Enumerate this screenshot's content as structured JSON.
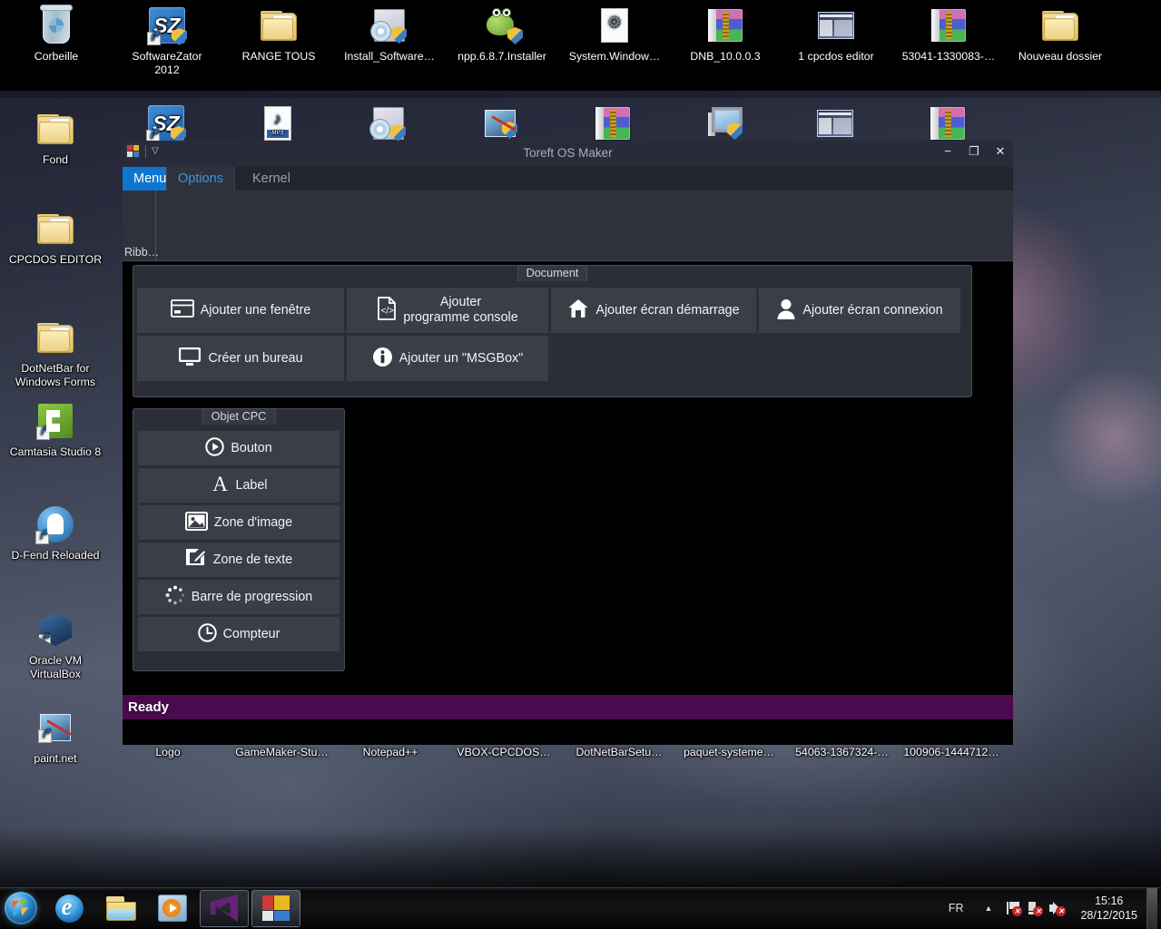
{
  "desktop": {
    "icons_row1": [
      {
        "label": "Corbeille",
        "icon": "recycle-bin-icon"
      },
      {
        "label": "SoftwareZator 2012",
        "icon": "softwarezator-icon"
      },
      {
        "label": "RANGE TOUS",
        "icon": "folder-icon"
      },
      {
        "label": "Install_Software…",
        "icon": "installer-icon"
      },
      {
        "label": "npp.6.8.7.Installer",
        "icon": "notepadpp-installer-icon"
      },
      {
        "label": "System.Window…",
        "icon": "system-file-icon"
      },
      {
        "label": "DNB_10.0.0.3",
        "icon": "winrar-archive-icon"
      },
      {
        "label": "1 cpcdos editor",
        "icon": "screenshot-icon"
      },
      {
        "label": "53041-1330083-…",
        "icon": "winrar-archive-icon"
      },
      {
        "label": "Nouveau dossier",
        "icon": "folder-icon"
      }
    ],
    "icons_row2": [
      {
        "icon": "softwarezator-icon"
      },
      {
        "icon": "mp3-file-icon"
      },
      {
        "icon": "installer-icon"
      },
      {
        "icon": "paintnet-installer-icon"
      },
      {
        "icon": "winrar-archive-icon"
      },
      {
        "icon": "system-config-icon"
      },
      {
        "icon": "screenshot-icon"
      },
      {
        "icon": "winrar-archive-icon"
      }
    ],
    "icons_left": [
      {
        "label": "Fond",
        "icon": "folder-icon"
      },
      {
        "label": "CPCDOS EDITOR",
        "icon": "folder-icon"
      },
      {
        "label": "DotNetBar for Windows Forms",
        "icon": "folder-icon"
      },
      {
        "label": "Camtasia Studio 8",
        "icon": "camtasia-icon"
      },
      {
        "label": "D-Fend Reloaded",
        "icon": "dfend-icon"
      },
      {
        "label": "Oracle VM VirtualBox",
        "icon": "virtualbox-icon"
      },
      {
        "label": "paint.net",
        "icon": "paintnet-icon"
      }
    ]
  },
  "window": {
    "title": "Toreft OS Maker",
    "quick_access": {
      "logo": "app-logo-icon",
      "dropdown": "chevron-down-icon"
    },
    "controls": {
      "minimize": "−",
      "maximize": "❐",
      "close": "✕"
    },
    "tabs": [
      {
        "label": "Menu",
        "state": "application"
      },
      {
        "label": "Options",
        "state": "selected"
      },
      {
        "label": "Kernel",
        "state": "normal"
      }
    ],
    "ribbon_group_label": "Ribb…",
    "panels": {
      "document": {
        "caption": "Document",
        "buttons": [
          {
            "label": "Ajouter une fenêtre",
            "icon": "window-icon"
          },
          {
            "label": "Ajouter\nprogramme console",
            "icon": "code-file-icon"
          },
          {
            "label": "Ajouter écran démarrage",
            "icon": "home-icon"
          },
          {
            "label": "Ajouter écran connexion",
            "icon": "user-icon"
          },
          {
            "label": "Créer un bureau",
            "icon": "monitor-icon"
          },
          {
            "label": "Ajouter un \"MSGBox\"",
            "icon": "info-icon"
          }
        ]
      },
      "objet_cpc": {
        "caption": "Objet CPC",
        "buttons": [
          {
            "label": "Bouton",
            "icon": "play-circle-icon"
          },
          {
            "label": "Label",
            "icon": "letter-a-icon"
          },
          {
            "label": "Zone d'image",
            "icon": "image-icon"
          },
          {
            "label": "Zone de texte",
            "icon": "edit-pencil-icon"
          },
          {
            "label": "Barre de progression",
            "icon": "spinner-icon"
          },
          {
            "label": "Compteur",
            "icon": "clock-icon"
          }
        ]
      }
    },
    "status": {
      "text": "Ready",
      "color": "#4b0a4d"
    }
  },
  "behind_window_labels": [
    "Logo",
    "GameMaker-Stu…",
    "Notepad++",
    "VBOX-CPCDOS…",
    "DotNetBarSetu…",
    "paquet-systeme…",
    "54063-1367324-…",
    "100906-1444712…"
  ],
  "taskbar": {
    "start": "start-orb-icon",
    "buttons": [
      {
        "name": "internet-explorer",
        "icon": "internet-explorer-icon"
      },
      {
        "name": "windows-explorer",
        "icon": "folder-explorer-icon"
      },
      {
        "name": "windows-media-player",
        "icon": "media-player-icon"
      },
      {
        "name": "visual-studio",
        "icon": "visual-studio-icon"
      },
      {
        "name": "toreft-os-maker",
        "icon": "app-logo-icon"
      }
    ],
    "tray": {
      "language": "FR",
      "show_hidden": "chevron-up-icon",
      "icons": [
        {
          "name": "action-center-flag-icon",
          "badge": "✕"
        },
        {
          "name": "network-icon",
          "badge": "✕"
        },
        {
          "name": "volume-icon",
          "badge": "✕"
        }
      ],
      "time": "15:16",
      "date": "28/12/2015"
    }
  },
  "accent": {
    "tab_active_bg": "#0f76cf",
    "tab_selected_text": "#3b95e0",
    "panel_bg": "#2b2e36",
    "button_bg": "#3a3e47",
    "titlebar_bg": "#282c3a",
    "status_bg": "#4b0a4d"
  }
}
